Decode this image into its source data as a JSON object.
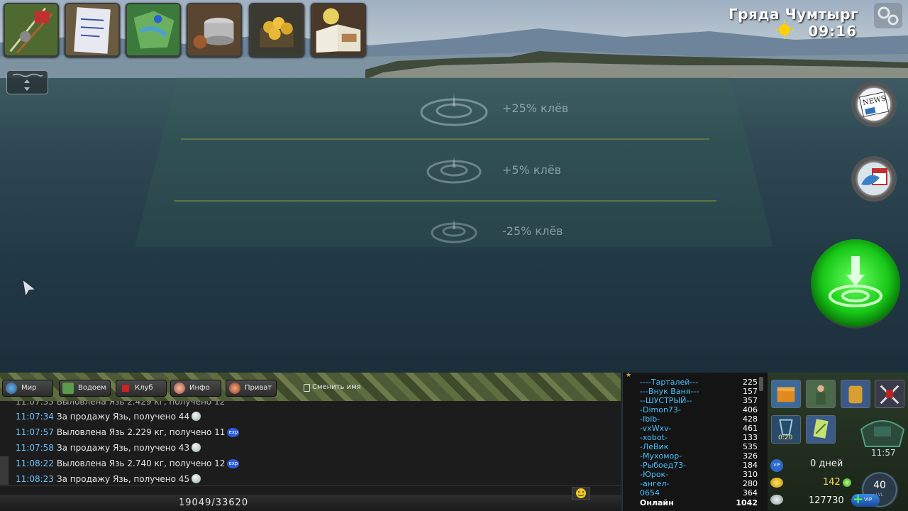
{
  "hud": {
    "location": "Гряда Чумтырг",
    "time": "09:16",
    "weather_icon": "sun-icon"
  },
  "toolbar": [
    {
      "name": "tackle-button",
      "icon": "fishing-rods-icon"
    },
    {
      "name": "quests-button",
      "icon": "notepad-icon"
    },
    {
      "name": "map-button",
      "icon": "map-icon"
    },
    {
      "name": "bait-button",
      "icon": "pot-icon"
    },
    {
      "name": "shop-button",
      "icon": "coins-icon"
    },
    {
      "name": "journal-button",
      "icon": "book-icon"
    }
  ],
  "zones": [
    {
      "label": "+25% клёв"
    },
    {
      "label": "+5% клёв"
    },
    {
      "label": "-25% клёв"
    }
  ],
  "chat": {
    "tabs": [
      {
        "label": "Мир",
        "icon": "globe-icon"
      },
      {
        "label": "Водоем",
        "icon": "map-icon"
      },
      {
        "label": "Клуб",
        "icon": "flag-icon"
      },
      {
        "label": "Инфо",
        "icon": "info-avatar-icon"
      },
      {
        "label": "Приват",
        "icon": "private-avatar-icon"
      },
      {
        "label": "Сменить имя",
        "icon": "rename-icon"
      }
    ],
    "lines": [
      {
        "time": "11:07:34",
        "text": "За продажу Язь, получено 44",
        "icon": "coin"
      },
      {
        "time": "11:07:57",
        "text": "Выловлена Язь 2.229 кг, получено 11",
        "icon": "exp"
      },
      {
        "time": "11:07:58",
        "text": "За продажу Язь, получено 43",
        "icon": "coin"
      },
      {
        "time": "11:08:22",
        "text": "Выловлена Язь 2.740 кг, получено 12",
        "icon": "exp"
      },
      {
        "time": "11:08:23",
        "text": "За продажу Язь, получено 45",
        "icon": "coin"
      }
    ],
    "exp_badge": "exp",
    "counter": "19049/33620"
  },
  "players": [
    {
      "name": "----Тарталей---",
      "value": "225"
    },
    {
      "name": "---Внук Ваня---",
      "value": "157"
    },
    {
      "name": "--ШУСТРЫЙ--",
      "value": "357"
    },
    {
      "name": "-Dimon73-",
      "value": "406"
    },
    {
      "name": "-Ibib-",
      "value": "428"
    },
    {
      "name": "-vxWxv-",
      "value": "461"
    },
    {
      "name": "-xobot-",
      "value": "133"
    },
    {
      "name": "-ЛеВик",
      "value": "535"
    },
    {
      "name": "-Мухомор-",
      "value": "326"
    },
    {
      "name": "-Рыбоед73-",
      "value": "184"
    },
    {
      "name": "-Юрок-",
      "value": "310"
    },
    {
      "name": "-ангел-",
      "value": "280"
    },
    {
      "name": "0654",
      "value": "364"
    },
    {
      "name": "Онлайн",
      "value": "1042"
    }
  ],
  "stats": {
    "slot_timer": "0:20",
    "clock": "11:57",
    "vip_days": "0 дней",
    "level": "40",
    "level_label": "LVL",
    "green_coins": "142",
    "silver": "127730",
    "vip_label": "VIP"
  }
}
